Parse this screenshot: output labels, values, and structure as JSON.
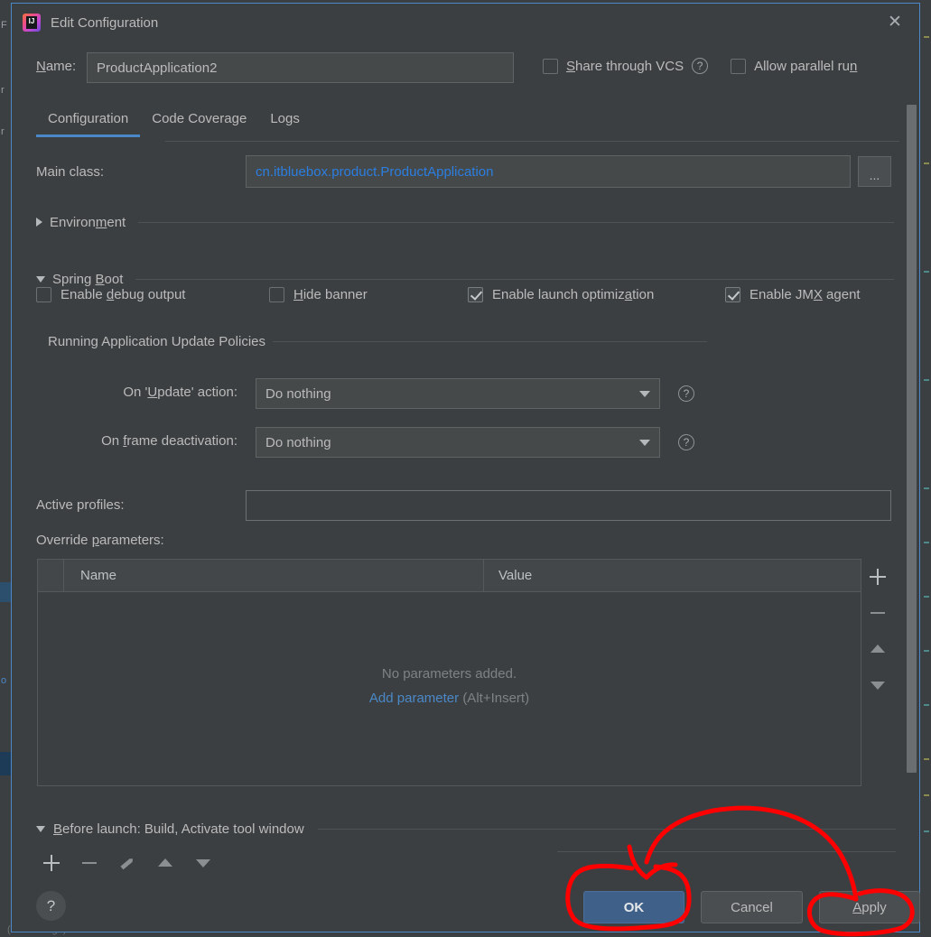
{
  "window": {
    "title": "Edit Configuration",
    "app_icon": "intellij-idea-logo",
    "close_icon": "✕",
    "border_color": "#4a88c7"
  },
  "name_row": {
    "label": "Name:",
    "label_mnemonic": "N",
    "value": "ProductApplication2",
    "placeholder": "",
    "share_vcs": {
      "label": "Share through VCS",
      "mnemonic": "S",
      "checked": false
    },
    "share_vcs_help": "?",
    "allow_parallel": {
      "label": "Allow parallel run",
      "mnemonic": "n",
      "checked": false
    }
  },
  "tabs": [
    {
      "label": "Configuration",
      "active": true
    },
    {
      "label": "Code Coverage",
      "active": false
    },
    {
      "label": "Logs",
      "active": false
    }
  ],
  "main_class": {
    "label": "Main class:",
    "value": "cn.itbluebox.product.ProductApplication",
    "value_color": "#2b7ee0",
    "browse_label": "..."
  },
  "environment": {
    "label": "Environment",
    "mnemonic": "m",
    "expanded": false
  },
  "spring_boot": {
    "label": "Spring Boot",
    "mnemonic": "B",
    "expanded": true,
    "checkboxes": [
      {
        "label": "Enable debug output",
        "mnemonic": "d",
        "checked": false
      },
      {
        "label": "Hide banner",
        "mnemonic": "H",
        "checked": false
      },
      {
        "label": "Enable launch optimization",
        "mnemonic": "a",
        "checked": true
      },
      {
        "label": "Enable JMX agent",
        "mnemonic": "X",
        "checked": true
      }
    ]
  },
  "update_policies": {
    "section_label": "Running Application Update Policies",
    "rows": [
      {
        "label": "On 'Update' action:",
        "mnemonic": "U",
        "value": "Do nothing",
        "help": "?"
      },
      {
        "label": "On frame deactivation:",
        "mnemonic": "f",
        "value": "Do nothing",
        "help": "?"
      }
    ]
  },
  "active_profiles": {
    "label": "Active profiles:",
    "value": "",
    "placeholder": ""
  },
  "override_parameters": {
    "label": "Override parameters:",
    "mnemonic": "p",
    "columns": [
      "Name",
      "Value"
    ],
    "rows": [],
    "empty_text": "No parameters added.",
    "add_link": "Add parameter",
    "add_shortcut": "(Alt+Insert)",
    "add_link_color": "#4a88c7",
    "tools": [
      "add-icon",
      "remove-icon",
      "move-up-icon",
      "move-down-icon"
    ]
  },
  "before_launch": {
    "label": "Before launch: Build, Activate tool window",
    "mnemonic": "B",
    "expanded": true,
    "tools": [
      "add-icon",
      "remove-icon",
      "edit-icon",
      "move-up-icon",
      "move-down-icon"
    ]
  },
  "footer": {
    "help_label": "?",
    "ok_label": "OK",
    "cancel_label": "Cancel",
    "apply_label": "Apply",
    "apply_mnemonic": "A",
    "ok_background": "#3f6089"
  },
  "annotations": {
    "color": "#ff0000",
    "marks": [
      "circle-around-ok-button",
      "circle-around-apply-button",
      "arc-connecting-apply-to-ok",
      "arrow-head-into-ok-button"
    ]
  },
  "background": {
    "bottom_left_text": "(xx secs ago)"
  }
}
